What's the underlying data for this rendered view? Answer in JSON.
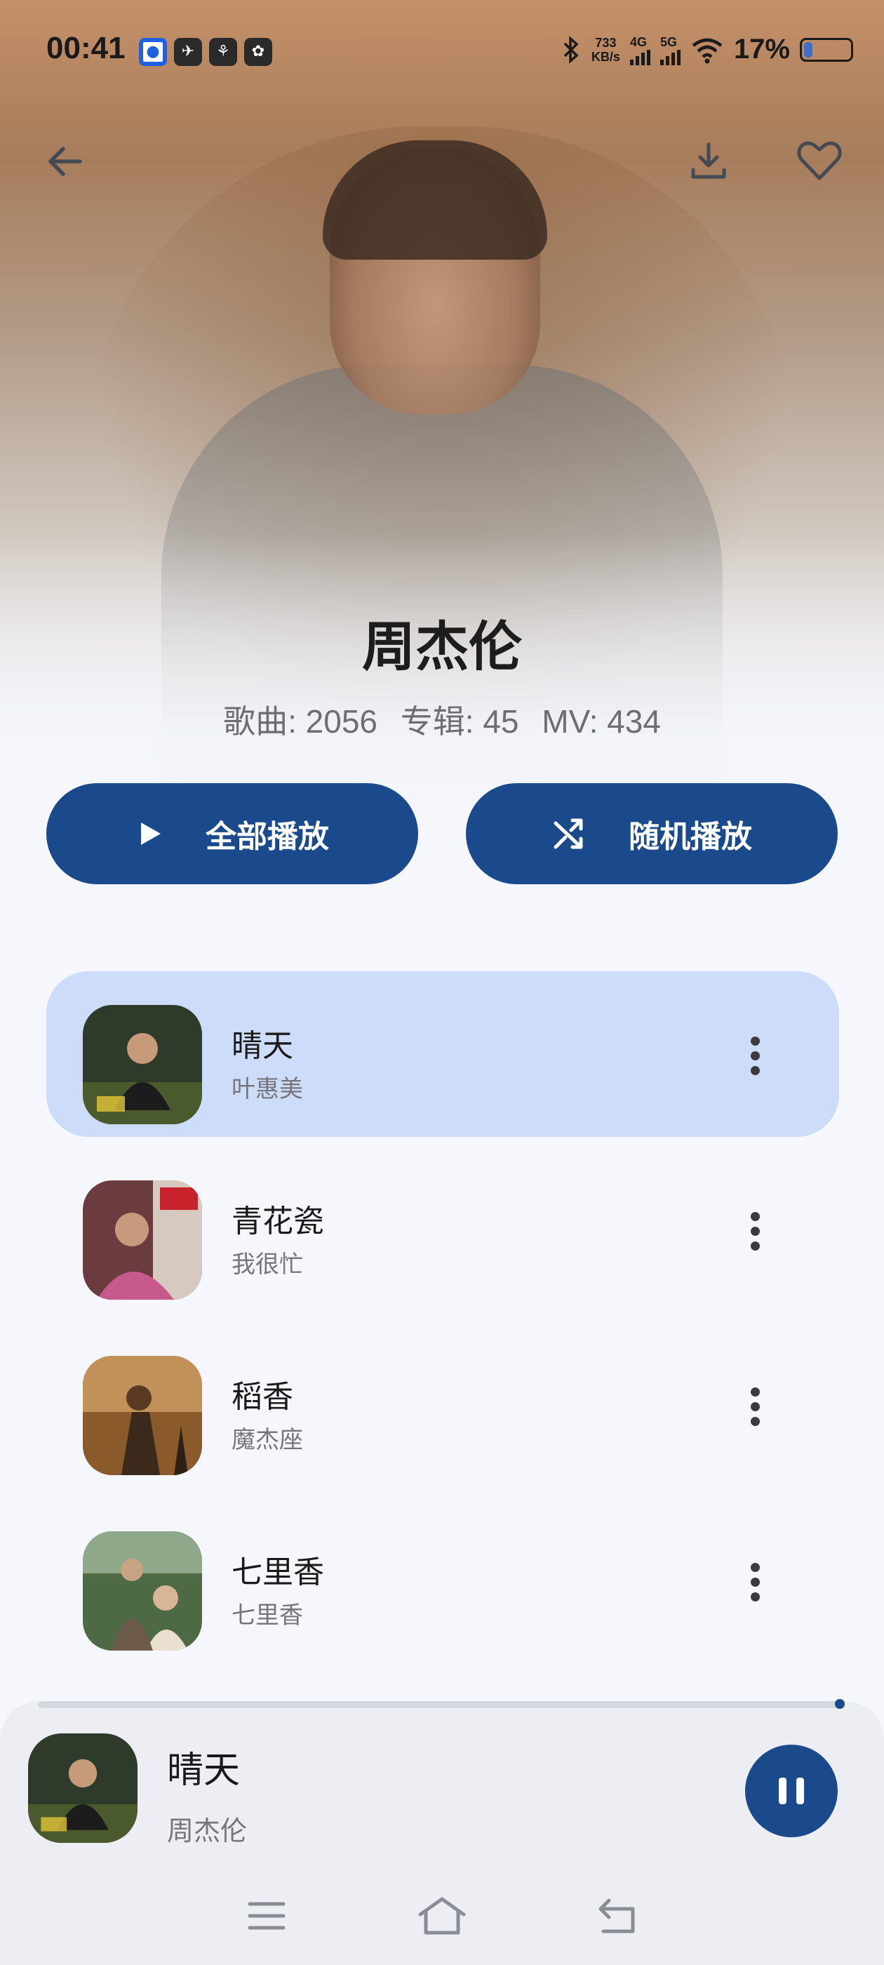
{
  "status_bar": {
    "time": "00:41",
    "net_speed_value": "733",
    "net_speed_unit": "KB/s",
    "network_4g": "4G",
    "network_5g": "5G",
    "battery_percent": "17%",
    "battery_level": 0.17
  },
  "artist": {
    "name": "周杰伦",
    "stats": {
      "songs": "歌曲: 2056",
      "albums": "专辑: 45",
      "mvs": "MV: 434"
    }
  },
  "actions": {
    "play_all": "全部播放",
    "shuffle": "随机播放"
  },
  "songs": [
    {
      "title": "晴天",
      "subtitle": "叶惠美",
      "active": true
    },
    {
      "title": "青花瓷",
      "subtitle": "我很忙"
    },
    {
      "title": "稻香",
      "subtitle": "魔杰座"
    },
    {
      "title": "七里香",
      "subtitle": "七里香"
    }
  ],
  "now_playing": {
    "title": "晴天",
    "artist": "周杰伦",
    "progress": 1.0
  },
  "colors": {
    "accent": "#1b4a8c",
    "active_row": "#cddcf9",
    "background": "#f6f7fc"
  }
}
